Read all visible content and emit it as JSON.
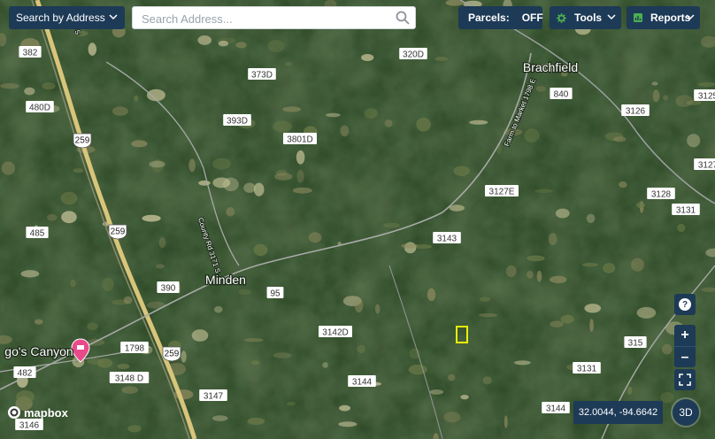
{
  "toolbar": {
    "search_by_label": "Search by Address",
    "search_placeholder": "Search Address...",
    "parcels_label": "Parcels:",
    "parcels_state": "OFF",
    "tools_label": "Tools",
    "reports_label": "Reports"
  },
  "map": {
    "places": [
      "Brachfield",
      "Minden",
      "go's Canyon"
    ],
    "road_labels": [
      "382",
      "480D",
      "485",
      "482",
      "3146",
      "259",
      "373D",
      "320D",
      "393D",
      "3801D",
      "840",
      "3126",
      "3127E",
      "3128",
      "3131",
      "3143",
      "390",
      "95",
      "1798",
      "3142D",
      "3144",
      "3148 D",
      "3147",
      "315",
      "3131",
      "3144",
      "259",
      "259",
      "259",
      "3127",
      "3125"
    ],
    "road_names": [
      "Farm to Market 1798 E",
      "County Rd 3171 S",
      "7 S"
    ],
    "colors": {
      "marker_pin": "#e84a8a",
      "highlight_parcel": "#e9f00c",
      "ui_dark": "#1d3a57"
    }
  },
  "controls": {
    "help_icon": "?",
    "zoom_in": "+",
    "zoom_out": "–",
    "fullscreen_icon": "fullscreen-icon"
  },
  "status": {
    "coordinates": "32.0044, -94.6642",
    "button_3d": "3D",
    "attribution": "mapbox"
  }
}
